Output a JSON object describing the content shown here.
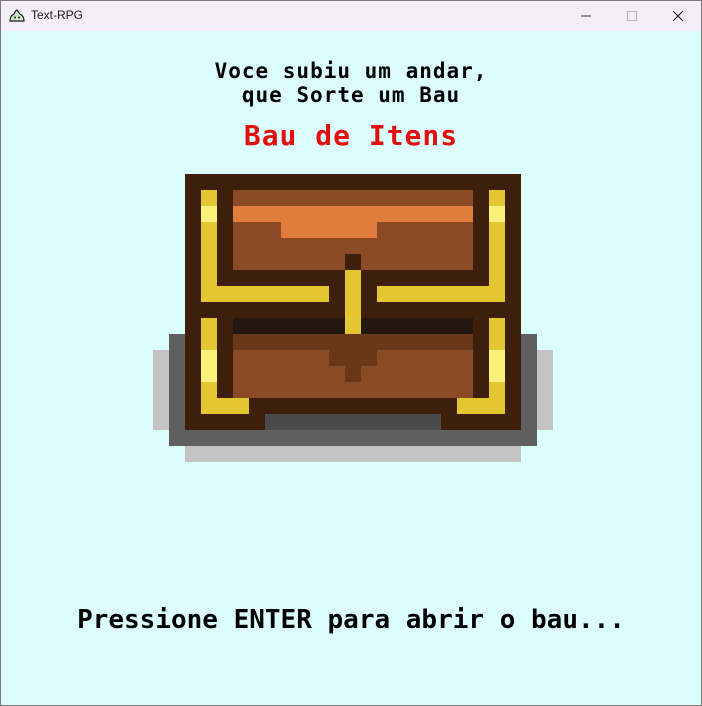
{
  "window": {
    "title": "Text-RPG",
    "icon": "slime-app-icon"
  },
  "controls": {
    "minimize_icon": "minimize-icon",
    "maximize_icon": "maximize-icon",
    "close_icon": "close-icon"
  },
  "game": {
    "message_line1": "Voce subiu um andar,",
    "message_line2": "que Sorte um Bau",
    "chest_title": "Bau de Itens",
    "chest_image": "treasure-chest",
    "prompt": "Pressione ENTER para abrir o bau..."
  },
  "colors": {
    "background": "#dbfdfd",
    "title_red": "#e20f0f",
    "text": "#000000"
  }
}
